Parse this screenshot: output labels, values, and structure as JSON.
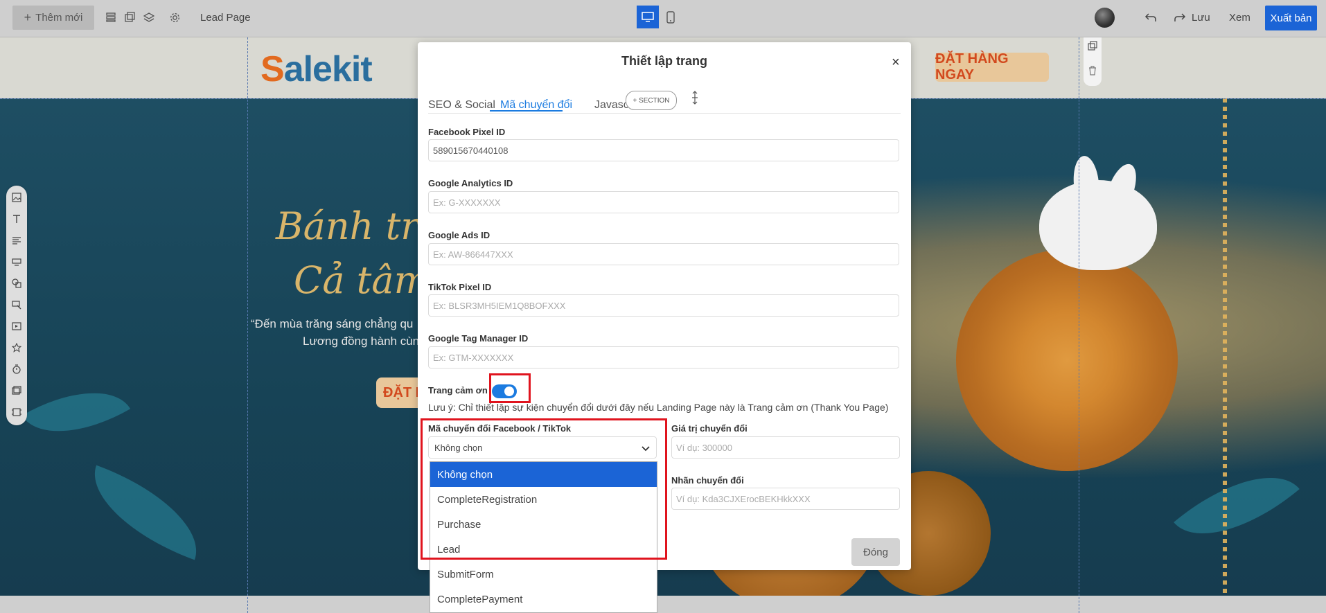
{
  "toolbar": {
    "add_label": "Thêm mới",
    "page_name": "Lead Page",
    "save_label": "Lưu",
    "view_label": "Xem",
    "publish_label": "Xuất bản"
  },
  "canvas": {
    "logo": "Salekit",
    "cta_top": "ĐẶT HÀNG NGAY",
    "hero_line1": "Bánh trun",
    "hero_line2": "Cả tâm t",
    "quote_line1": "“Đến mùa trăng sáng chẳng qu",
    "quote_line2": "Lương đồng hành cùn",
    "cta_mid": "ĐẶT H"
  },
  "modal": {
    "title": "Thiết lập trang",
    "close_icon": "×",
    "tabs": [
      "SEO & Social",
      "Mã chuyển đổi",
      "Javascri"
    ],
    "section_pill": "+ SECTION",
    "fields": {
      "fb_pixel": {
        "label": "Facebook Pixel ID",
        "value": "589015670440108"
      },
      "ga": {
        "label": "Google Analytics ID",
        "placeholder": "Ex: G-XXXXXXX"
      },
      "gads": {
        "label": "Google Ads ID",
        "placeholder": "Ex: AW-866447XXX"
      },
      "tiktok": {
        "label": "TikTok Pixel ID",
        "placeholder": "Ex: BLSR3MH5IEM1Q8BOFXXX"
      },
      "gtm": {
        "label": "Google Tag Manager ID",
        "placeholder": "Ex: GTM-XXXXXXX"
      }
    },
    "thankyou_label": "Trang cảm ơn",
    "thankyou_on": true,
    "note": "Lưu ý: Chỉ thiết lập sự kiện chuyển đổi dưới đây nếu Landing Page này là Trang cảm ơn (Thank You Page)",
    "conv_label": "Mã chuyển đổi Facebook / TikTok",
    "conv_selected": "Không chọn",
    "conv_value_label": "Giá trị chuyển đổi",
    "conv_value_placeholder": "Ví dụ: 300000",
    "conv_tag_label": "Nhãn chuyển đổi",
    "conv_tag_placeholder": "Ví dụ: Kda3CJXErocBEKHkkXXX",
    "close_label": "Đóng"
  },
  "dropdown": {
    "options": [
      "Không chọn",
      "CompleteRegistration",
      "Purchase",
      "Lead",
      "SubmitForm",
      "CompletePayment"
    ]
  },
  "colors": {
    "accent": "#1b64d6",
    "highlight": "#e0141e"
  }
}
